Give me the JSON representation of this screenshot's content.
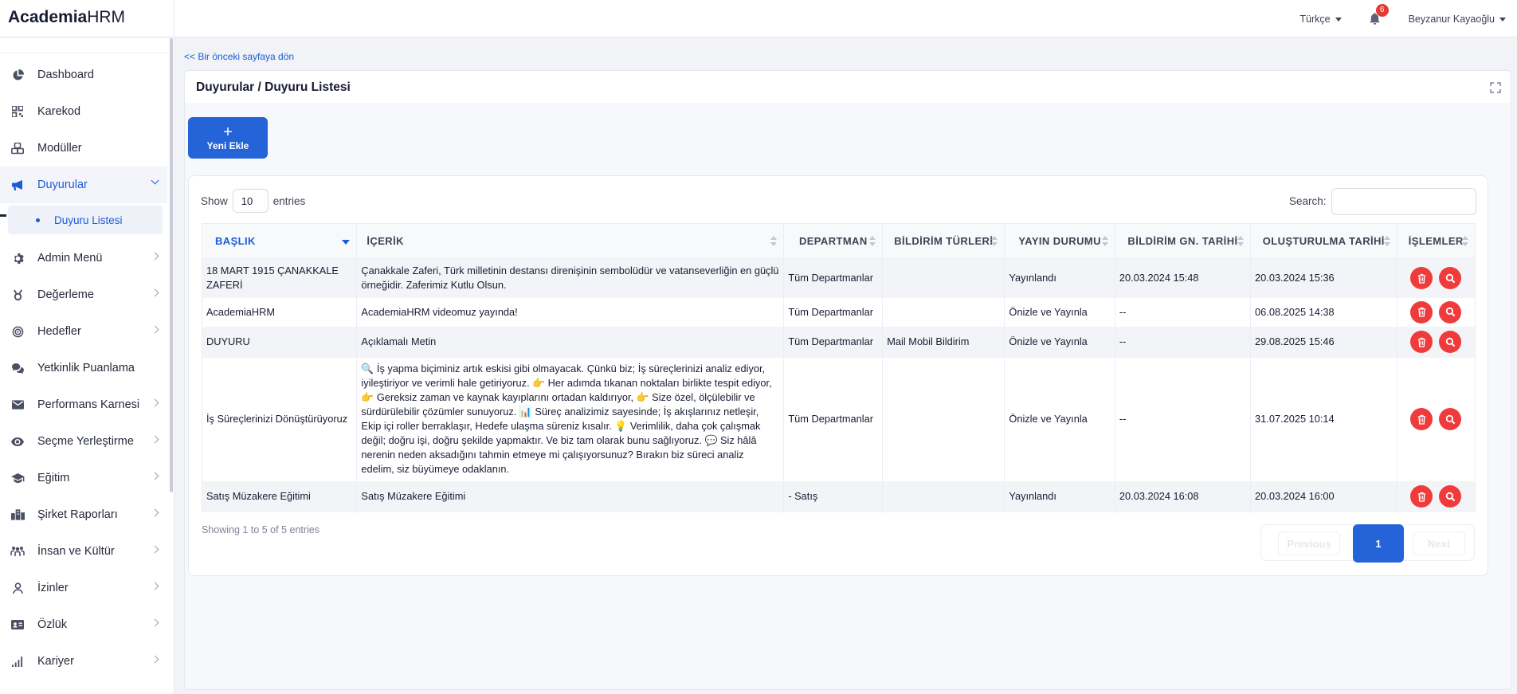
{
  "app": {
    "brand_bold": "Academia",
    "brand_rest": "HRM"
  },
  "topbar": {
    "language": "Türkçe",
    "notification_count": "6",
    "user_name": "Beyzanur Kayaoğlu"
  },
  "sidebar": {
    "items": [
      {
        "label": "Dashboard",
        "icon": "chart-pie-icon"
      },
      {
        "label": "Karekod",
        "icon": "qrcode-icon"
      },
      {
        "label": "Modüller",
        "icon": "cubes-icon"
      },
      {
        "label": "Duyurular",
        "icon": "megaphone-icon"
      },
      {
        "label": "Admin Menü",
        "icon": "gear-icon"
      },
      {
        "label": "Değerleme",
        "icon": "scale-icon"
      },
      {
        "label": "Hedefler",
        "icon": "target-icon"
      },
      {
        "label": "Yetkinlik Puanlama",
        "icon": "comments-icon"
      },
      {
        "label": "Performans Karnesi",
        "icon": "envelope-icon"
      },
      {
        "label": "Seçme Yerleştirme",
        "icon": "eye-icon"
      },
      {
        "label": "Eğitim",
        "icon": "graduation-cap-icon"
      },
      {
        "label": "Şirket Raporları",
        "icon": "building-icon"
      },
      {
        "label": "İnsan ve Kültür",
        "icon": "people-icon"
      },
      {
        "label": "İzinler",
        "icon": "user-icon"
      },
      {
        "label": "Özlük",
        "icon": "id-card-icon"
      },
      {
        "label": "Kariyer",
        "icon": "signal-bars-icon"
      }
    ],
    "sub_item": "Duyuru Listesi"
  },
  "page": {
    "back_link": "<< Bir önceki sayfaya dön",
    "title": "Duyurular / Duyuru Listesi",
    "add_button": "Yeni Ekle",
    "show_label": "Show",
    "page_length": "10",
    "entries_label": "entries",
    "search_label": "Search:",
    "info": "Showing 1 to 5 of 5 entries",
    "pagination": {
      "previous": "Previous",
      "current": "1",
      "next": "Next"
    }
  },
  "table": {
    "columns": [
      "BAŞLIK",
      "İÇERİK",
      "DEPARTMAN",
      "BİLDİRİM TÜRLERİ",
      "YAYIN DURUMU",
      "BİLDİRİM GN. TARİHİ",
      "OLUŞTURULMA TARİHİ",
      "İŞLEMLER"
    ],
    "rows": [
      {
        "title": "18 MART 1915 ÇANAKKALE ZAFERİ",
        "content": "Çanakkale Zaferi, Türk milletinin destansı direnişinin sembolüdür ve vatanseverliğin en güçlü örneğidir. Zaferimiz Kutlu Olsun.",
        "department": "Tüm Departmanlar",
        "notification_types": "",
        "status": "Yayınlandı",
        "status_is_link": false,
        "notify_date": "20.03.2024 15:48",
        "created": "20.03.2024 15:36"
      },
      {
        "title": "AcademiaHRM",
        "content": "AcademiaHRM videomuz yayında!",
        "department": "Tüm Departmanlar",
        "notification_types": "",
        "status": "Önizle ve Yayınla",
        "status_is_link": true,
        "notify_date": "--",
        "created": "06.08.2025 14:38"
      },
      {
        "title": "DUYURU",
        "content": "Açıklamalı Metin",
        "department": "Tüm Departmanlar",
        "notification_types": "Mail Mobil Bildirim",
        "status": "Önizle ve Yayınla",
        "status_is_link": true,
        "notify_date": "--",
        "created": "29.08.2025 15:46"
      },
      {
        "title": "İş Süreçlerinizi Dönüştürüyoruz",
        "content": "🔍 İş yapma biçiminiz artık eskisi gibi olmayacak. Çünkü biz; İş süreçlerinizi analiz ediyor, iyileştiriyor ve verimli hale getiriyoruz. 👉 Her adımda tıkanan noktaları birlikte tespit ediyor, 👉 Gereksiz zaman ve kaynak kayıplarını ortadan kaldırıyor, 👉 Size özel, ölçülebilir ve sürdürülebilir çözümler sunuyoruz. 📊 Süreç analizimiz sayesinde; İş akışlarınız netleşir, Ekip içi roller berraklaşır, Hedefe ulaşma süreniz kısalır. 💡 Verimlilik, daha çok çalışmak değil; doğru işi, doğru şekilde yapmaktır. Ve biz tam olarak bunu sağlıyoruz. 💬 Siz hâlâ nerenin neden aksadığını tahmin etmeye mi çalışıyorsunuz? Bırakın biz süreci analiz edelim, siz büyümeye odaklanın.",
        "department": "Tüm Departmanlar",
        "notification_types": "",
        "status": "Önizle ve Yayınla",
        "status_is_link": true,
        "notify_date": "--",
        "created": "31.07.2025 10:14"
      },
      {
        "title": "Satış Müzakere Eğitimi",
        "content": "Satış Müzakere Eğitimi",
        "department": "- Satış",
        "notification_types": "",
        "status": "Yayınlandı",
        "status_is_link": false,
        "notify_date": "20.03.2024 16:08",
        "created": "20.03.2024 16:00"
      }
    ]
  },
  "colors": {
    "accent": "#2563d9",
    "link": "#1b5bd8",
    "danger": "#ef3b3b",
    "row_alt": "#f3f4f7"
  }
}
